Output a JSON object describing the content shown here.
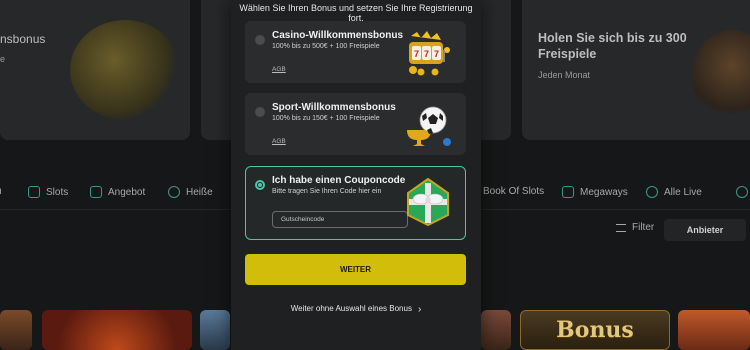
{
  "modal": {
    "heading": "Wählen Sie Ihren Bonus und setzen Sie Ihre Registrierung fort.",
    "options": [
      {
        "title": "Casino-Willkommensbonus",
        "description": "100% bis zu 500€ + 100 Freispiele",
        "link": "AGB",
        "selected": false,
        "image": "slot-machine-777"
      },
      {
        "title": "Sport-Willkommensbonus",
        "description": "100% bis zu 150€ + 100 Freispiele",
        "link": "AGB",
        "selected": false,
        "image": "soccer-ball-trophy"
      }
    ],
    "coupon": {
      "title": "Ich habe einen Couponcode",
      "description": "Bitte tragen Sie Ihren Code hier ein",
      "input_placeholder": "Gutscheincode",
      "input_value": "",
      "selected": true,
      "image": "gift-box-bow"
    },
    "submit_label": "WEITER",
    "skip_label": "Weiter ohne Auswahl eines Bonus",
    "accent_color": "#4cc4aa",
    "button_color": "#d2bd0a"
  },
  "background": {
    "promo_left": {
      "title": "nsbonus",
      "subtitle": "e"
    },
    "promo_right": {
      "title": "Holen Sie sich bis zu 300 Freispiele",
      "subtitle": "Jeden Monat"
    },
    "categories": [
      {
        "label": "Slots",
        "icon": "slot-icon"
      },
      {
        "label": "Angebot",
        "icon": "gift-icon"
      },
      {
        "label": "Heiße",
        "icon": "fire-icon"
      },
      {
        "label": "Book Of Slots",
        "icon": "book-icon"
      },
      {
        "label": "Megaways",
        "icon": "megaways-icon"
      },
      {
        "label": "Alle Live",
        "icon": "live-icon"
      }
    ],
    "filter_label": "Filter",
    "provider_label": "Anbieter",
    "tile_text": "Bonus"
  }
}
